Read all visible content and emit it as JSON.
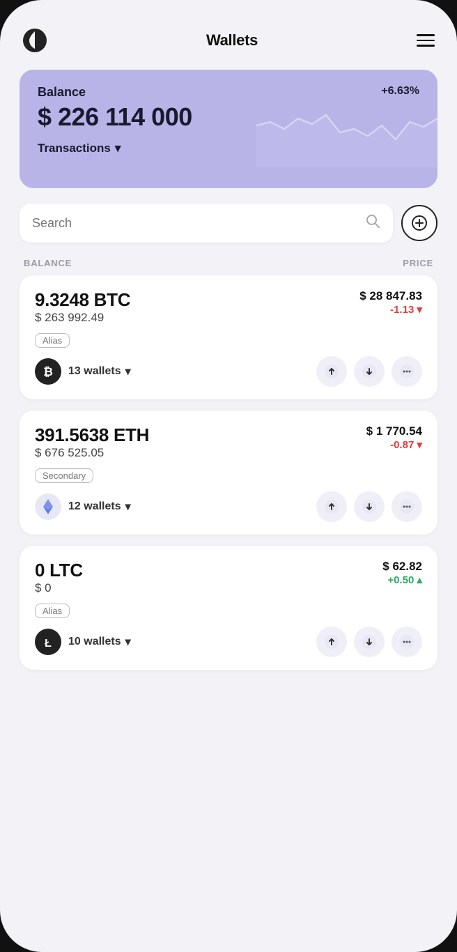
{
  "header": {
    "title": "Wallets",
    "menu_label": "menu"
  },
  "balance_card": {
    "label": "Balance",
    "percent": "+6.63%",
    "amount": "$ 226 114 000",
    "transactions_label": "Transactions"
  },
  "search": {
    "placeholder": "Search",
    "add_label": "+"
  },
  "columns": {
    "balance": "BALANCE",
    "price": "PRICE"
  },
  "cryptos": [
    {
      "amount": "9.3248 BTC",
      "usd_value": "$ 263 992.49",
      "price": "$ 28 847.83",
      "change": "-1.13",
      "change_dir": "negative",
      "alias": "Alias",
      "wallets": "13 wallets",
      "logo_type": "btc"
    },
    {
      "amount": "391.5638 ETH",
      "usd_value": "$ 676 525.05",
      "price": "$ 1 770.54",
      "change": "-0.87",
      "change_dir": "negative",
      "alias": "Secondary",
      "wallets": "12 wallets",
      "logo_type": "eth"
    },
    {
      "amount": "0 LTC",
      "usd_value": "$ 0",
      "price": "$ 62.82",
      "change": "+0.50",
      "change_dir": "positive",
      "alias": "Alias",
      "wallets": "10 wallets",
      "logo_type": "ltc"
    }
  ]
}
